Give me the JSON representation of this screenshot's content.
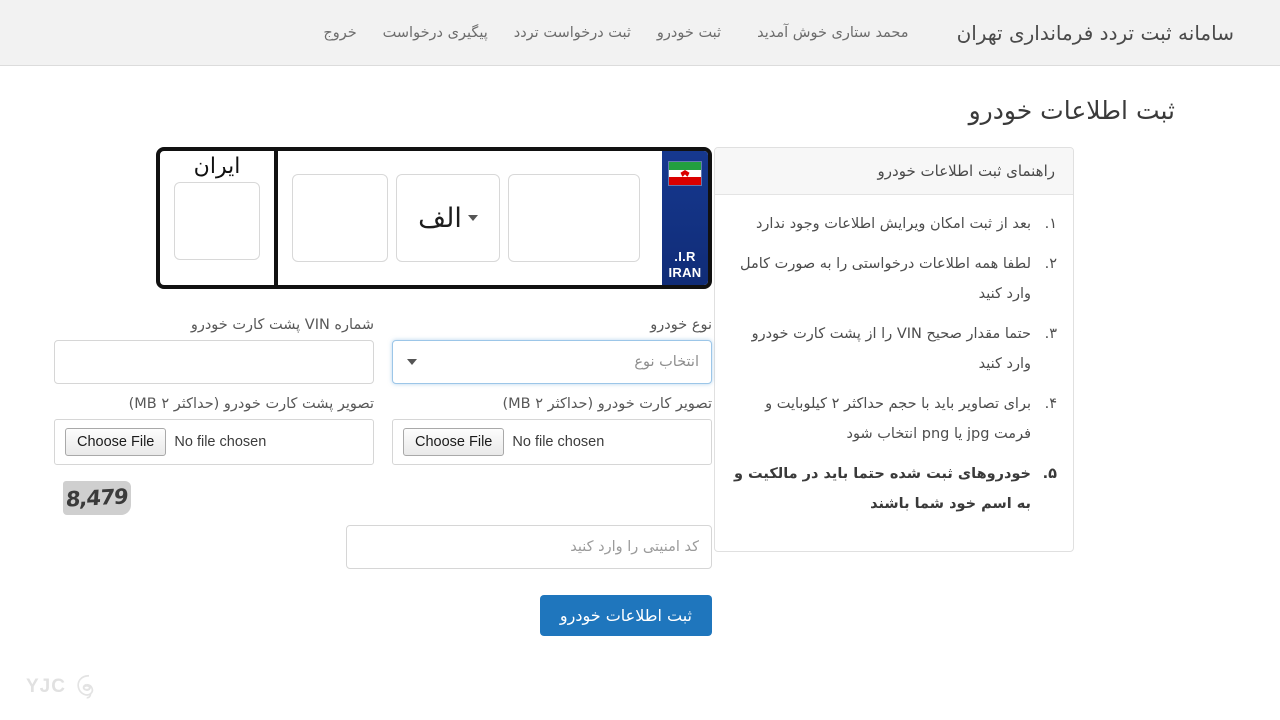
{
  "navbar": {
    "brand": "سامانه ثبت تردد فرمانداری تهران",
    "welcome": "محمد ستاری خوش آمدید",
    "links": [
      {
        "label": "ثبت خودرو"
      },
      {
        "label": "ثبت درخواست تردد"
      },
      {
        "label": "پیگیری درخواست"
      },
      {
        "label": "خروج"
      }
    ]
  },
  "page": {
    "title": "ثبت اطلاعات خودرو"
  },
  "plate": {
    "country_line1": "I.R.",
    "country_line2": "IRAN",
    "iran_label": "ایران",
    "left_number": "",
    "letter": "الف",
    "right_number": "",
    "region_code": "",
    "flag_name": "iran-flag"
  },
  "form": {
    "vehicle_type": {
      "label": "نوع خودرو",
      "selected": "انتخاب نوع"
    },
    "vin": {
      "label": "شماره VIN پشت کارت خودرو",
      "value": "",
      "placeholder": ""
    },
    "card_front": {
      "label": "تصویر کارت خودرو (حداکثر ۲ MB)",
      "button": "Choose File",
      "status": "No file chosen"
    },
    "card_back": {
      "label": "تصویر پشت کارت خودرو (حداکثر ۲ MB)",
      "button": "Choose File",
      "status": "No file chosen"
    },
    "captcha": {
      "code": "8,479",
      "placeholder": "کد امنیتی را وارد کنید",
      "value": ""
    },
    "submit_label": "ثبت اطلاعات خودرو"
  },
  "guide": {
    "title": "راهنمای ثبت اطلاعات خودرو",
    "items": [
      {
        "num": "۱.",
        "text": "بعد از ثبت امکان ویرایش اطلاعات وجود ندارد",
        "bold": false
      },
      {
        "num": "۲.",
        "text": "لطفا همه اطلاعات درخواستی را به صورت کامل وارد کنید",
        "bold": false
      },
      {
        "num": "۳.",
        "text": "حتما مقدار صحیح VIN را از پشت کارت خودرو وارد کنید",
        "bold": false
      },
      {
        "num": "۴.",
        "text": "برای تصاویر باید با حجم حداکثر ۲ کیلوبایت و فرمت jpg یا png انتخاب شود",
        "bold": false
      },
      {
        "num": "۵.",
        "text": "خودروهای ثبت شده حتما باید در مالکیت و به اسم خود شما باشند",
        "bold": true
      }
    ]
  },
  "watermark": {
    "text": "YJC"
  },
  "colors": {
    "navbar_bg": "#f2f2f2",
    "plate_blue": "#12379b",
    "submit_blue": "#1f76bd",
    "focus_border": "#9cc6e8"
  }
}
